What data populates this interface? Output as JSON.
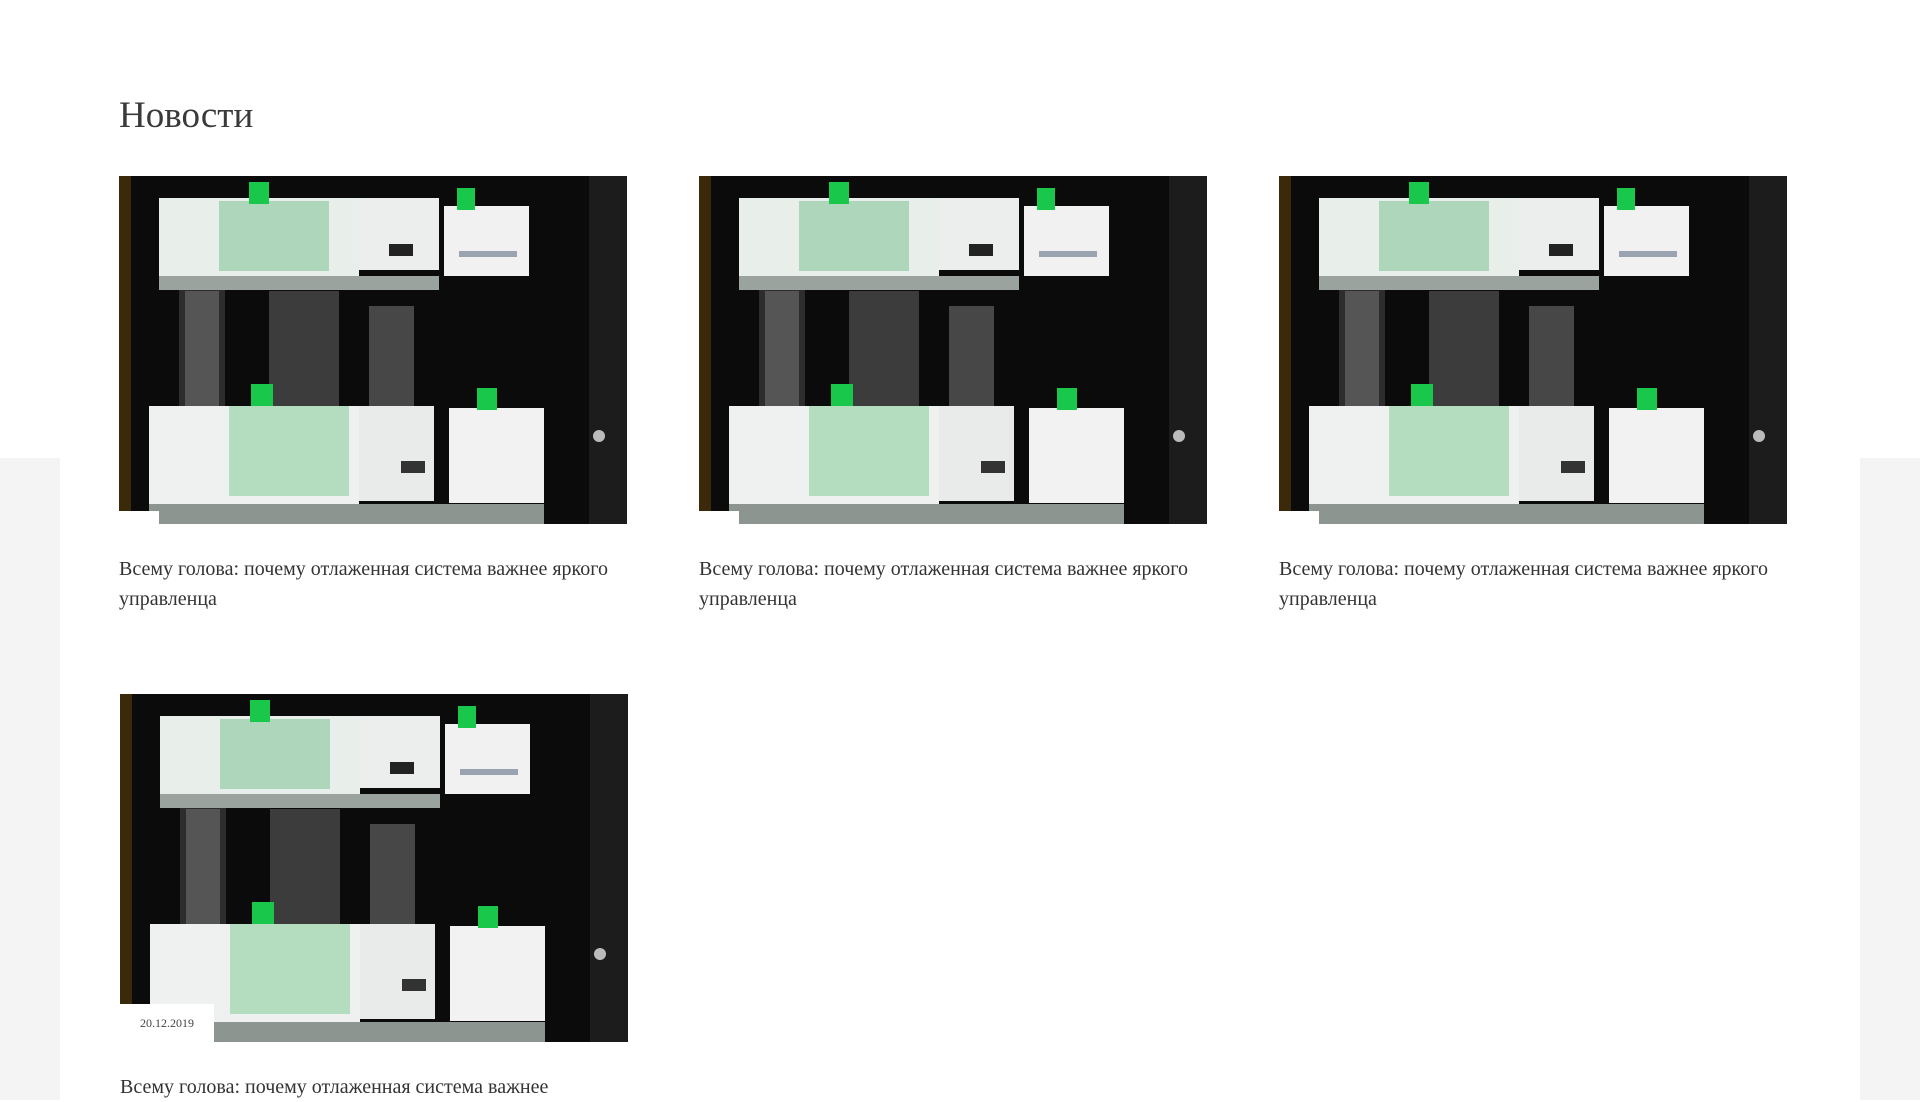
{
  "section": {
    "title": "Новости"
  },
  "news": [
    {
      "title": "Всему голова: почему отлаженная система важнее яркого управленца",
      "image": "banknote-bundles-photo"
    },
    {
      "title": "Всему голова: почему отлаженная система важнее яркого управленца",
      "image": "banknote-bundles-photo"
    },
    {
      "title": "Всему голова: почему отлаженная система важнее яркого управленца",
      "image": "banknote-bundles-photo"
    },
    {
      "title": "Всему голова: почему отлаженная система важнее",
      "date": "20.12.2019",
      "image": "banknote-bundles-photo"
    }
  ],
  "colors": {
    "background": "#ffffff",
    "side_band": "#f4f4f4",
    "text": "#333333"
  }
}
